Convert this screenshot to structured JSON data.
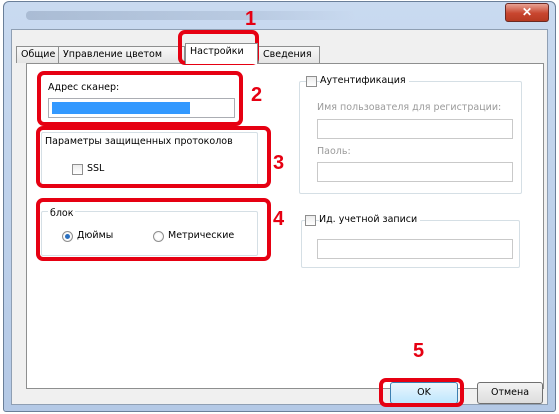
{
  "dialog": {
    "close_glyph": "✕"
  },
  "tabs": [
    {
      "label": "Общие"
    },
    {
      "label": "Управление цветом"
    },
    {
      "label": "Настройки"
    },
    {
      "label": "Сведения"
    }
  ],
  "scanner": {
    "label": "Адрес сканер:",
    "value": ""
  },
  "protocols": {
    "label": "Параметры защищенных протоколов",
    "ssl_label": "SSL",
    "ssl_checked": false
  },
  "units": {
    "label": "блок",
    "options": [
      {
        "label": "Дюймы",
        "selected": true
      },
      {
        "label": "Метрические",
        "selected": false
      }
    ]
  },
  "auth": {
    "label": "Аутентификация",
    "checked": false,
    "username_label": "Имя пользователя для регистрации:",
    "username_value": "",
    "password_label": "Паоль:",
    "password_value": ""
  },
  "account": {
    "label": "Ид. учетной записи",
    "checked": false,
    "value": ""
  },
  "buttons": {
    "ok": "OK",
    "cancel": "Отмена"
  },
  "callouts": [
    "1",
    "2",
    "3",
    "4",
    "5"
  ],
  "colors": {
    "callout": "#e60012",
    "selection": "#3399ff",
    "title_bar": "#b4c9e6",
    "close_button": "#c8462f"
  }
}
